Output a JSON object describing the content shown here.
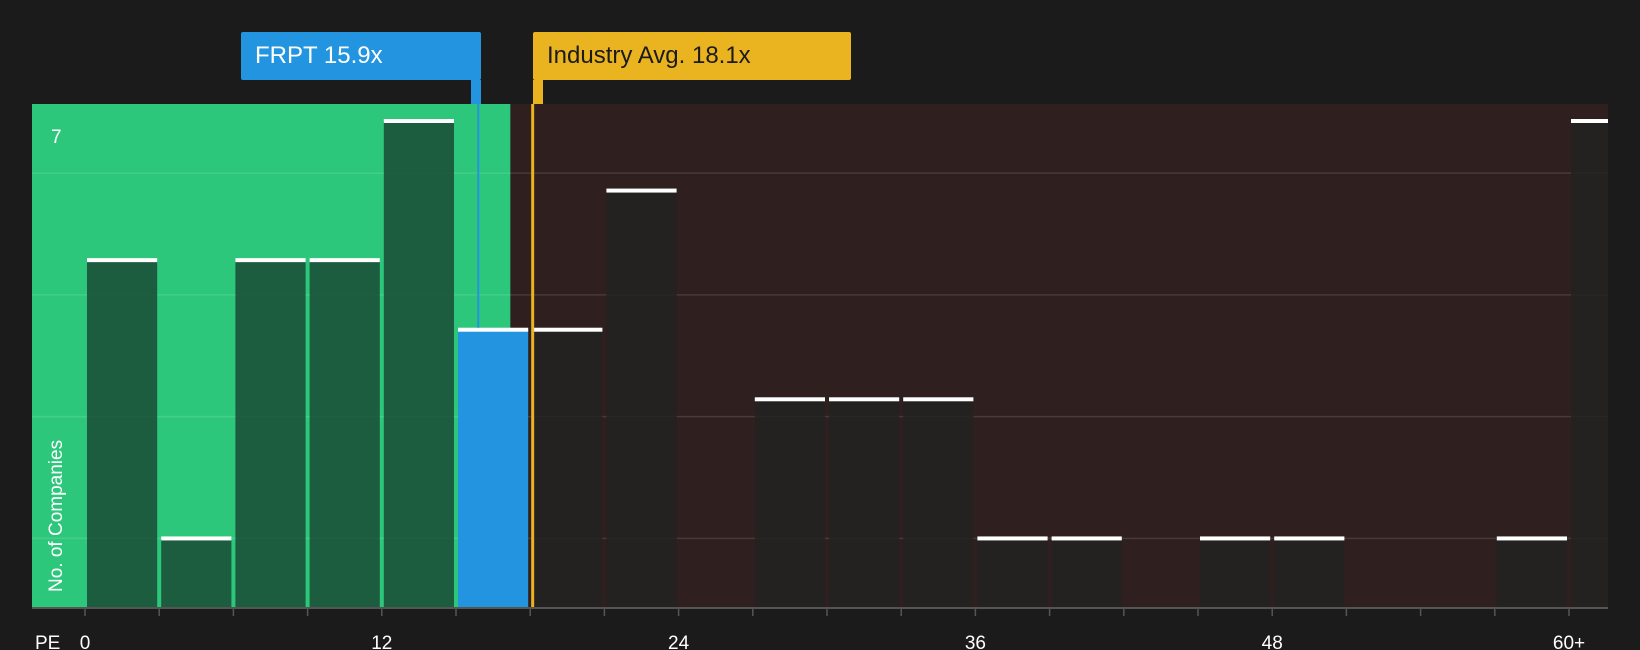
{
  "company_label": "FRPT 15.9x",
  "industry_label": "Industry Avg. 18.1x",
  "colors": {
    "company": "#2394df",
    "industry": "#eab320",
    "undervalued_zone": "#2dc77c",
    "overvalued_zone": "#2f1f1f",
    "bar": "#222222",
    "bar_cap": "#ffffff",
    "background": "#1b1b1b"
  },
  "chart_data": {
    "type": "bar",
    "xlabel": "PE",
    "ylabel": "No. of Companies",
    "x_ticks": [
      "0",
      "12",
      "24",
      "36",
      "48",
      "60+"
    ],
    "x_tick_values": [
      0,
      12,
      24,
      36,
      48,
      60
    ],
    "y_ticks": [
      "7"
    ],
    "ylim": [
      0,
      7
    ],
    "xlim": [
      -2.2,
      61.5
    ],
    "bin_width": 3,
    "bins": [
      {
        "start": 0,
        "value": 5
      },
      {
        "start": 3,
        "value": 1
      },
      {
        "start": 6,
        "value": 5
      },
      {
        "start": 9,
        "value": 5
      },
      {
        "start": 12,
        "value": 7
      },
      {
        "start": 15,
        "value": 4,
        "highlight": true
      },
      {
        "start": 18,
        "value": 4
      },
      {
        "start": 21,
        "value": 6
      },
      {
        "start": 27,
        "value": 3
      },
      {
        "start": 30,
        "value": 3
      },
      {
        "start": 33,
        "value": 3
      },
      {
        "start": 36,
        "value": 1
      },
      {
        "start": 39,
        "value": 1
      },
      {
        "start": 45,
        "value": 1
      },
      {
        "start": 48,
        "value": 1
      },
      {
        "start": 57,
        "value": 1
      },
      {
        "start": 60,
        "value": 7
      }
    ],
    "company_value": 15.9,
    "industry_avg": 18.1,
    "undervalued_zone_end": 17.2,
    "grid": true
  }
}
